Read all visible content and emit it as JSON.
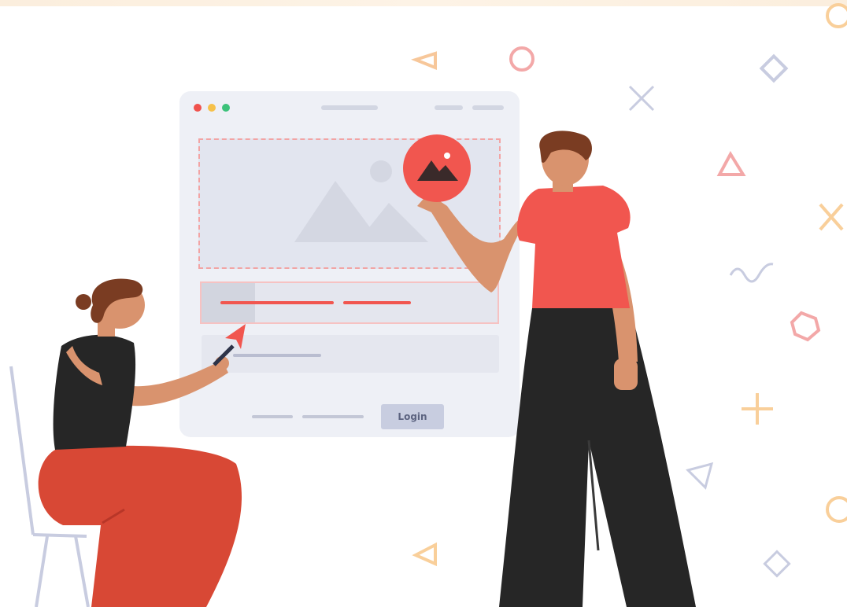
{
  "mockup": {
    "login_button_label": "Login"
  },
  "icons": {
    "image_badge": "image-icon",
    "cursor": "cursor-arrow-icon"
  },
  "colors": {
    "accent": "#f1564f",
    "window": "#eef0f6",
    "dark": "#272727",
    "skin": "#d9936e",
    "hair": "#7a3c22"
  }
}
